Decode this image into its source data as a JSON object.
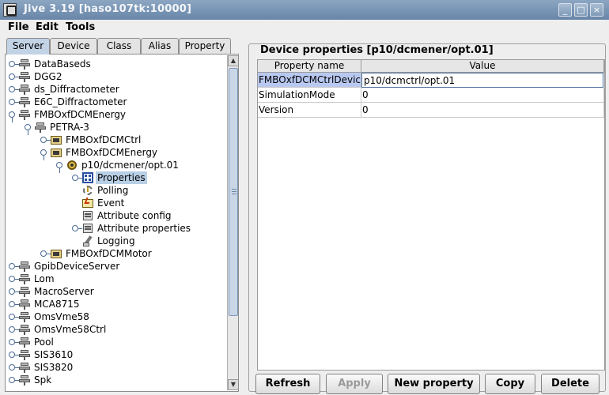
{
  "window": {
    "title": "Jive 3.19  [haso107tk:10000]"
  },
  "menu": [
    "File",
    "Edit",
    "Tools"
  ],
  "tabs": [
    "Server",
    "Device",
    "Class",
    "Alias",
    "Property"
  ],
  "tree": [
    "DataBaseds",
    "DGG2",
    "ds_Diffractometer",
    "E6C_Diffractometer",
    "FMBOxfDCMEnergy",
    "PETRA-3",
    "FMBOxfDCMCtrl",
    "FMBOxfDCMEnergy",
    "p10/dcmener/opt.01",
    "Properties",
    "Polling",
    "Event",
    "Attribute config",
    "Attribute properties",
    "Logging",
    "FMBOxfDCMMotor",
    "GpibDeviceServer",
    "Lom",
    "MacroServer",
    "MCA8715",
    "OmsVme58",
    "OmsVme58Ctrl",
    "Pool",
    "SIS3610",
    "SIS3820",
    "Spk"
  ],
  "icons": {
    "server": "server-icon",
    "class": "class-icon",
    "device": "device-icon",
    "properties": "properties-icon",
    "polling": "polling-icon",
    "event": "event-icon",
    "attribute_config": "attribute-config-icon",
    "attribute_properties": "attribute-properties-icon",
    "logging": "logging-icon"
  },
  "panel": {
    "title": "Device properties [p10/dcmener/opt.01]",
    "columns": [
      "Property name",
      "Value"
    ],
    "rows": [
      {
        "name": "FMBOxfDCMCtrlDevice",
        "value": "p10/dcmctrl/opt.01"
      },
      {
        "name": "SimulationMode",
        "value": "0"
      },
      {
        "name": "Version",
        "value": "0"
      }
    ]
  },
  "buttons": [
    "Refresh",
    "Apply",
    "New property",
    "Copy",
    "Delete"
  ],
  "colors": {
    "titlebar": "#7893b1",
    "selection": "#b8cfe5",
    "active_tab": "#c3d3e6"
  }
}
